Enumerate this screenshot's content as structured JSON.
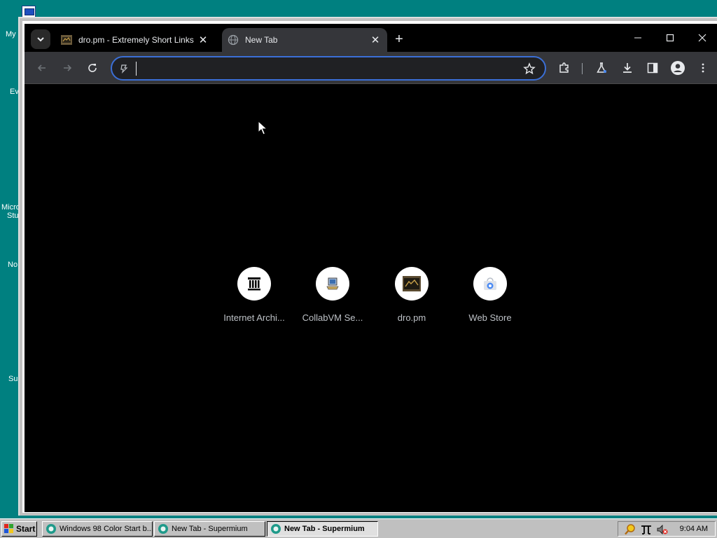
{
  "desktop": {
    "icon_labels": [
      "My",
      "Ev",
      "Micro",
      "Stu",
      "No",
      "Su"
    ]
  },
  "browser": {
    "tabs": [
      {
        "title": "dro.pm - Extremely Short Links",
        "active": false
      },
      {
        "title": "New Tab",
        "active": true
      }
    ],
    "new_tab": "+",
    "address": {
      "value": "",
      "placeholder": ""
    },
    "shortcuts": [
      {
        "label": "Internet Archi...",
        "icon": "archive-building-icon"
      },
      {
        "label": "CollabVM Se...",
        "icon": "collabvm-icon"
      },
      {
        "label": "dro.pm",
        "icon": "dro-pm-icon"
      },
      {
        "label": "Web Store",
        "icon": "web-store-icon"
      }
    ]
  },
  "taskbar": {
    "start_label": "Start",
    "tasks": [
      {
        "label": "Windows 98 Color Start b...",
        "active": false
      },
      {
        "label": "New Tab - Supermium",
        "active": false
      },
      {
        "label": "New Tab - Supermium",
        "active": true
      }
    ],
    "time": "9:04 AM"
  },
  "colors": {
    "desktop": "#008080",
    "omnibox_border": "#3b6fd6",
    "toolbar": "#35363a"
  }
}
